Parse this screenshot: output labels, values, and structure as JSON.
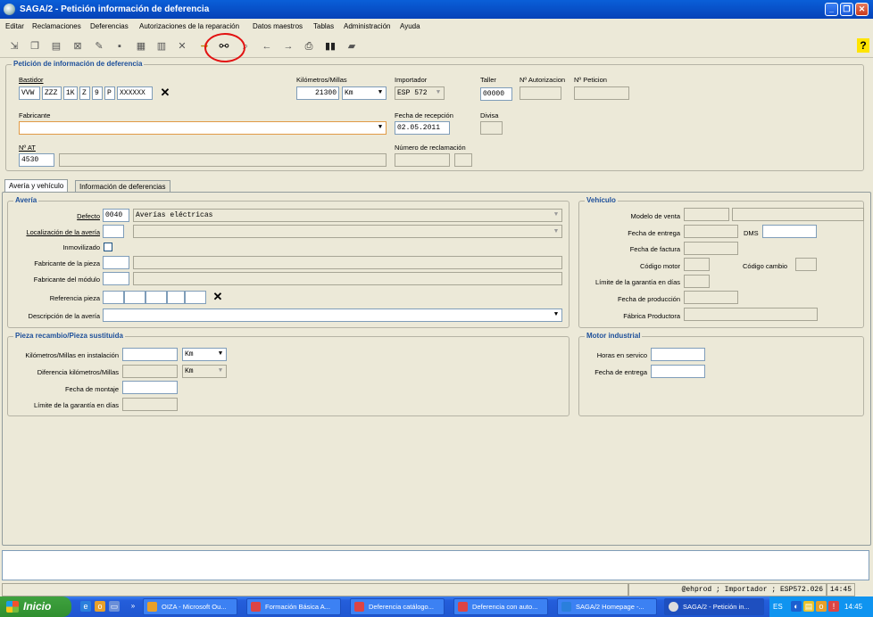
{
  "window": {
    "title": "SAGA/2 - Petición información de deferencia"
  },
  "menu": [
    "Editar",
    "Reclamaciones",
    "Deferencias",
    "Autorizaciones de la reparación",
    "Datos maestros",
    "Tablas",
    "Administración",
    "Ayuda"
  ],
  "toolbar_icons": [
    "import-icon",
    "copy-icon",
    "document-icon",
    "delete-doc-icon",
    "edit-icon",
    "save-icon",
    "form-icon",
    "report-icon",
    "close-x-icon",
    "arrow-in-icon",
    "binoculars-icon",
    "magnifier-icon",
    "back-arrow-icon",
    "forward-arrow-icon",
    "print-icon",
    "barcode-icon",
    "folder-icon",
    "help-icon"
  ],
  "header": {
    "legend": "Petición de información de deferencia",
    "bastidor_label": "Bastidor",
    "bastidor_parts": [
      "VVW",
      "ZZZ",
      "1K",
      "Z",
      "9",
      "P",
      "XXXXXX"
    ],
    "km_label": "Kilómetros/Millas",
    "km_value": "21300",
    "km_unit": "Km",
    "importador_label": "Importador",
    "importador_value": "ESP 572",
    "taller_label": "Taller",
    "taller_value": "00000",
    "autorizacion_label": "Nº Autorizacion",
    "peticion_label": "Nº Peticion",
    "fabricante_label": "Fabricante",
    "fecha_recepcion_label": "Fecha de recepción",
    "fecha_recepcion_value": "02.05.2011",
    "divisa_label": "Divisa",
    "nat_label": "Nº AT",
    "nat_value": "4530",
    "num_reclamacion_label": "Número de reclamación"
  },
  "tabs": [
    "Avería y vehículo",
    "Información de deferencias"
  ],
  "averia": {
    "legend": "Avería",
    "defecto_label": "Defecto",
    "defecto_code": "0040",
    "defecto_value": "Averías eléctricas",
    "localizacion_label": "Localización de la avería",
    "inmovilizado_label": "Inmovilizado",
    "fabricante_pieza_label": "Fabricante de la pieza",
    "fabricante_modulo_label": "Fabricante del módulo",
    "referencia_label": "Referencia pieza",
    "descripcion_label": "Descripción de la avería"
  },
  "vehiculo": {
    "legend": "Vehículo",
    "modelo_label": "Modelo de venta",
    "fecha_entrega_label": "Fecha de entrega",
    "dms_label": "DMS",
    "fecha_factura_label": "Fecha de factura",
    "codigo_motor_label": "Código motor",
    "codigo_cambio_label": "Código cambio",
    "limite_label": "Límite de la garantía en días",
    "fecha_produccion_label": "Fecha de producción",
    "fabrica_label": "Fábrica Productora"
  },
  "pieza": {
    "legend": "Pieza recambio/Pieza sustituida",
    "km_instalacion_label": "Kilómetros/Millas en instalación",
    "km_instalacion_unit": "Km",
    "diferencia_label": "Diferencia kilómetros/Millas",
    "diferencia_unit": "Km",
    "fecha_montaje_label": "Fecha de montaje",
    "limite_label": "Límite de la garantía en días"
  },
  "motor": {
    "legend": "Motor industrial",
    "horas_label": "Horas en servico",
    "fecha_entrega_label": "Fecha de entrega"
  },
  "status": {
    "session": "@ehprod ; Importador ; ESP572.026",
    "time": "14:45"
  },
  "taskbar": {
    "start_label": "Inicio",
    "tasks": [
      "OIZA - Microsoft Ou...",
      "Formación Básica A...",
      "Deferencia catálogo...",
      "Deferencia con auto...",
      "SAGA/2 Homepage -...",
      "SAGA/2 - Petición in..."
    ],
    "lang": "ES",
    "clock": "14:45"
  },
  "colors": {
    "title_bar": "#0642b8",
    "legend": "#1d4f9a",
    "highlight_circle": "#e21212",
    "taskbar": "#245edb"
  }
}
